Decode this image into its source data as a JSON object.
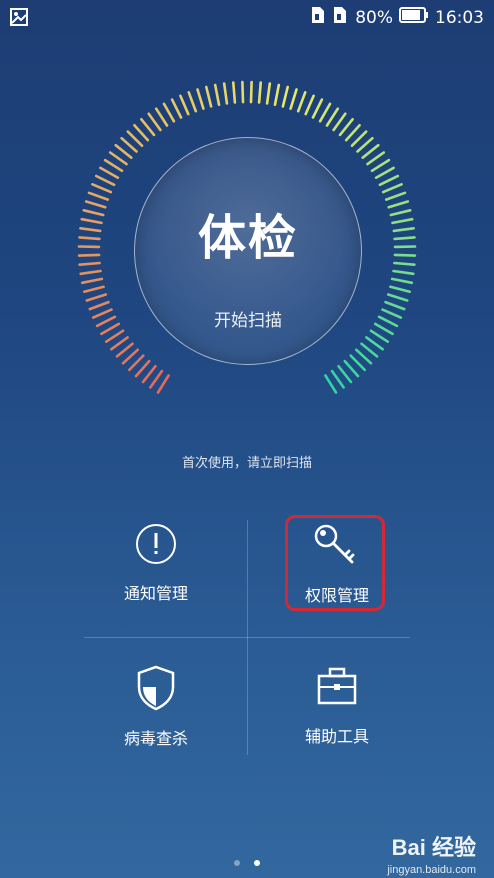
{
  "status_bar": {
    "battery_percent": "80%",
    "time": "16:03"
  },
  "scan": {
    "title": "体检",
    "action_label": "开始扫描",
    "hint": "首次使用，请立即扫描"
  },
  "tools": [
    {
      "label": "通知管理",
      "icon": "notification-icon"
    },
    {
      "label": "权限管理",
      "icon": "key-icon"
    },
    {
      "label": "病毒查杀",
      "icon": "shield-icon"
    },
    {
      "label": "辅助工具",
      "icon": "toolbox-icon"
    }
  ],
  "pager": {
    "pages": 2,
    "active": 1
  },
  "watermark": {
    "logo": "Bai 经验",
    "url": "jingyan.baidu.com"
  },
  "colors": {
    "accent_highlight": "#d32937",
    "gauge_start": "#e36b5a",
    "gauge_mid": "#e7e76a",
    "gauge_end": "#2ed6a3"
  }
}
